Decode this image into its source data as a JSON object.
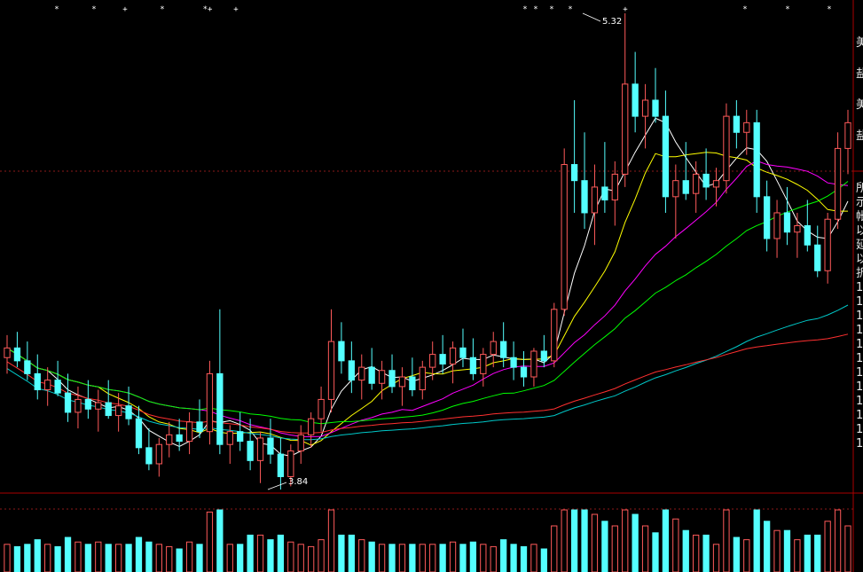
{
  "annotations": {
    "high_label": "5.32",
    "low_label": "3.84"
  },
  "side_panel": {
    "upper_chars": [
      "美",
      "盐",
      "美",
      "盐"
    ],
    "lower_chars": [
      "所",
      "示",
      "帐",
      "以",
      "延",
      "以",
      "折",
      "1",
      "1",
      "1",
      "1",
      "1",
      "1",
      "1",
      "1",
      "1",
      "1",
      "1",
      "1"
    ]
  },
  "top_markers": [
    "*",
    "*",
    "+",
    "*",
    "*+",
    "+",
    "*",
    "*",
    "*",
    "*",
    "+",
    "*",
    "*",
    "*",
    "*",
    "*",
    "+"
  ],
  "colors": {
    "background": "#000000",
    "up": "#ff5a5a",
    "down": "#54ffff",
    "ma5": "#ffffff",
    "ma10": "#ffff00",
    "ma20": "#ff00ff",
    "ma30": "#00ff00",
    "ma60": "#00c8c8",
    "ma120": "#ff3030",
    "separator": "#aa0000"
  },
  "chart_data": {
    "type": "candlestick",
    "y_high": 5.32,
    "y_low": 3.84,
    "ohlc_approx": [
      [
        4.25,
        4.32,
        4.2,
        4.28
      ],
      [
        4.28,
        4.33,
        4.22,
        4.24
      ],
      [
        4.24,
        4.3,
        4.18,
        4.2
      ],
      [
        4.2,
        4.26,
        4.12,
        4.15
      ],
      [
        4.15,
        4.22,
        4.1,
        4.18
      ],
      [
        4.18,
        4.24,
        4.13,
        4.14
      ],
      [
        4.14,
        4.2,
        4.05,
        4.08
      ],
      [
        4.08,
        4.16,
        4.03,
        4.12
      ],
      [
        4.12,
        4.18,
        4.06,
        4.09
      ],
      [
        4.09,
        4.15,
        4.02,
        4.11
      ],
      [
        4.11,
        4.18,
        4.06,
        4.07
      ],
      [
        4.07,
        4.14,
        4.02,
        4.1
      ],
      [
        4.1,
        4.16,
        4.04,
        4.06
      ],
      [
        4.06,
        4.1,
        3.95,
        3.97
      ],
      [
        3.97,
        4.03,
        3.9,
        3.92
      ],
      [
        3.92,
        4.0,
        3.88,
        3.98
      ],
      [
        3.98,
        4.05,
        3.94,
        4.01
      ],
      [
        4.01,
        4.06,
        3.96,
        3.99
      ],
      [
        3.99,
        4.08,
        3.95,
        4.05
      ],
      [
        4.05,
        4.12,
        4.0,
        4.02
      ],
      [
        4.02,
        4.24,
        3.98,
        4.2
      ],
      [
        4.2,
        4.4,
        3.95,
        3.98
      ],
      [
        3.98,
        4.04,
        3.92,
        4.02
      ],
      [
        4.02,
        4.08,
        3.96,
        3.99
      ],
      [
        3.99,
        4.06,
        3.9,
        3.93
      ],
      [
        3.93,
        4.02,
        3.86,
        4.0
      ],
      [
        4.0,
        4.06,
        3.92,
        3.95
      ],
      [
        3.95,
        4.0,
        3.84,
        3.88
      ],
      [
        3.88,
        3.98,
        3.85,
        3.96
      ],
      [
        3.96,
        4.04,
        3.92,
        4.01
      ],
      [
        4.01,
        4.08,
        3.97,
        4.06
      ],
      [
        4.06,
        4.16,
        4.02,
        4.12
      ],
      [
        4.12,
        4.4,
        4.08,
        4.3
      ],
      [
        4.3,
        4.36,
        4.2,
        4.24
      ],
      [
        4.24,
        4.3,
        4.14,
        4.18
      ],
      [
        4.18,
        4.26,
        4.12,
        4.22
      ],
      [
        4.22,
        4.28,
        4.15,
        4.17
      ],
      [
        4.17,
        4.24,
        4.12,
        4.21
      ],
      [
        4.21,
        4.26,
        4.14,
        4.16
      ],
      [
        4.16,
        4.22,
        4.1,
        4.19
      ],
      [
        4.19,
        4.25,
        4.13,
        4.15
      ],
      [
        4.15,
        4.24,
        4.12,
        4.22
      ],
      [
        4.22,
        4.3,
        4.18,
        4.26
      ],
      [
        4.26,
        4.32,
        4.2,
        4.23
      ],
      [
        4.23,
        4.3,
        4.17,
        4.28
      ],
      [
        4.28,
        4.34,
        4.22,
        4.25
      ],
      [
        4.25,
        4.31,
        4.18,
        4.2
      ],
      [
        4.2,
        4.28,
        4.16,
        4.26
      ],
      [
        4.26,
        4.33,
        4.22,
        4.3
      ],
      [
        4.3,
        4.36,
        4.22,
        4.25
      ],
      [
        4.25,
        4.3,
        4.18,
        4.22
      ],
      [
        4.22,
        4.27,
        4.16,
        4.19
      ],
      [
        4.19,
        4.28,
        4.16,
        4.27
      ],
      [
        4.27,
        4.32,
        4.22,
        4.24
      ],
      [
        4.24,
        4.42,
        4.22,
        4.4
      ],
      [
        4.4,
        4.9,
        4.38,
        4.85
      ],
      [
        4.85,
        5.05,
        4.7,
        4.8
      ],
      [
        4.8,
        4.95,
        4.65,
        4.7
      ],
      [
        4.7,
        4.85,
        4.6,
        4.78
      ],
      [
        4.78,
        4.92,
        4.7,
        4.74
      ],
      [
        4.74,
        4.86,
        4.66,
        4.82
      ],
      [
        4.82,
        5.32,
        4.78,
        5.1
      ],
      [
        5.1,
        5.2,
        4.95,
        5.0
      ],
      [
        5.0,
        5.1,
        4.9,
        5.05
      ],
      [
        5.05,
        5.15,
        4.98,
        5.0
      ],
      [
        5.0,
        5.08,
        4.7,
        4.75
      ],
      [
        4.75,
        4.85,
        4.62,
        4.8
      ],
      [
        4.8,
        4.92,
        4.74,
        4.76
      ],
      [
        4.76,
        4.86,
        4.7,
        4.82
      ],
      [
        4.82,
        4.9,
        4.74,
        4.78
      ],
      [
        4.78,
        4.84,
        4.72,
        4.8
      ],
      [
        4.8,
        5.04,
        4.76,
        5.0
      ],
      [
        5.0,
        5.05,
        4.9,
        4.95
      ],
      [
        4.95,
        5.02,
        4.88,
        4.98
      ],
      [
        4.98,
        5.02,
        4.7,
        4.75
      ],
      [
        4.75,
        4.8,
        4.58,
        4.62
      ],
      [
        4.62,
        4.74,
        4.56,
        4.7
      ],
      [
        4.7,
        4.78,
        4.6,
        4.64
      ],
      [
        4.64,
        4.7,
        4.56,
        4.66
      ],
      [
        4.66,
        4.74,
        4.58,
        4.6
      ],
      [
        4.6,
        4.66,
        4.5,
        4.52
      ],
      [
        4.52,
        4.7,
        4.48,
        4.68
      ],
      [
        4.68,
        4.95,
        4.65,
        4.9
      ],
      [
        4.9,
        5.02,
        4.82,
        4.98
      ]
    ]
  }
}
